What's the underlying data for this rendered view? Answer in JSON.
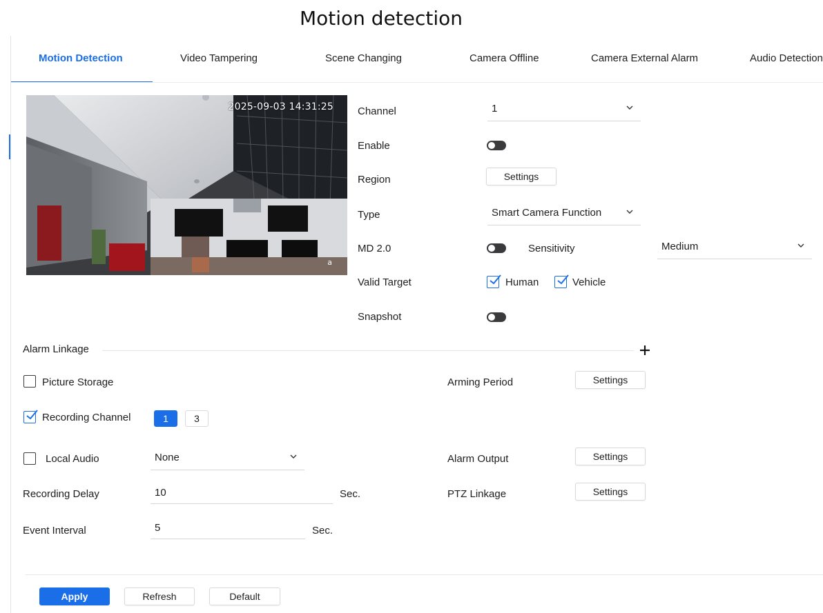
{
  "page": {
    "title": "Motion detection"
  },
  "tabs": [
    {
      "label": "Motion Detection",
      "active": true
    },
    {
      "label": "Video Tampering"
    },
    {
      "label": "Scene Changing"
    },
    {
      "label": "Camera Offline"
    },
    {
      "label": "Camera External Alarm"
    },
    {
      "label": "Audio Detection"
    }
  ],
  "preview": {
    "timestamp": "2025-09-03 14:31:25",
    "corner_mark": "a"
  },
  "settings": {
    "channel": {
      "label": "Channel",
      "value": "1"
    },
    "enable": {
      "label": "Enable",
      "on": false
    },
    "region": {
      "label": "Region",
      "button": "Settings"
    },
    "type": {
      "label": "Type",
      "value": "Smart Camera Function"
    },
    "md2": {
      "label": "MD 2.0",
      "on": false
    },
    "sensitivity": {
      "label": "Sensitivity",
      "value": "Medium"
    },
    "valid_target": {
      "label": "Valid Target",
      "human": "Human",
      "vehicle": "Vehicle",
      "human_checked": true,
      "vehicle_checked": true
    },
    "snapshot": {
      "label": "Snapshot",
      "on": false
    }
  },
  "linkage": {
    "section_title": "Alarm Linkage",
    "picture_storage": {
      "label": "Picture Storage",
      "checked": false
    },
    "arming_period": {
      "label": "Arming Period",
      "button": "Settings"
    },
    "recording_channel": {
      "label": "Recording Channel",
      "checked": true,
      "channels": [
        "1",
        "3"
      ],
      "selected": "1"
    },
    "local_audio": {
      "label": "Local Audio",
      "checked": false,
      "value": "None"
    },
    "alarm_output": {
      "label": "Alarm Output",
      "button": "Settings"
    },
    "recording_delay": {
      "label": "Recording Delay",
      "value": "10",
      "unit": "Sec."
    },
    "ptz_linkage": {
      "label": "PTZ Linkage",
      "button": "Settings"
    },
    "event_interval": {
      "label": "Event Interval",
      "value": "5",
      "unit": "Sec."
    }
  },
  "footer": {
    "apply": "Apply",
    "refresh": "Refresh",
    "default": "Default"
  },
  "colors": {
    "accent": "#1a6fe8",
    "toggle_off": "#3a3a3c",
    "text": "#1d1d1f"
  },
  "icons": [
    "chevron-down-icon",
    "plus-icon",
    "checkmark-icon"
  ]
}
